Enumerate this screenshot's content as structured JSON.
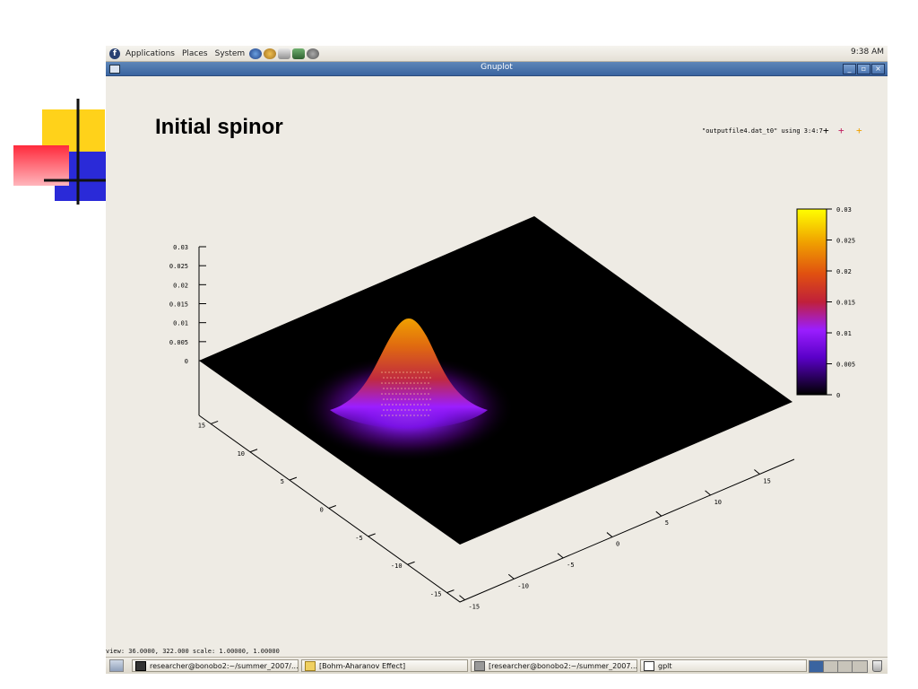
{
  "colors": {
    "slide_yellow": "#ffd21a",
    "slide_red": "#ff3344",
    "slide_blue": "#2a2ad8",
    "titlebar": "#3a64a0",
    "plot_surface": "#000000",
    "palette": [
      "#000000",
      "#5a00c8",
      "#9b1eff",
      "#c0203a",
      "#e05010",
      "#f0a000",
      "#ffff00"
    ]
  },
  "top_panel": {
    "menus": [
      "Applications",
      "Places",
      "System"
    ],
    "clock": "9:38 AM"
  },
  "window": {
    "title": "Gnuplot",
    "buttons": [
      "_",
      "▫",
      "×"
    ]
  },
  "chart_data": {
    "type": "surface",
    "title": "Initial spinor",
    "legend": "\"outputfile4.dat_t0\" using 3:4:7",
    "z_ticks": [
      "0",
      "0.005",
      "0.01",
      "0.015",
      "0.02",
      "0.025",
      "0.03"
    ],
    "zlim": [
      0,
      0.03
    ],
    "x_ticks": [
      "15",
      "10",
      "5",
      "0",
      "-5",
      "-10",
      "-15"
    ],
    "y_ticks": [
      "-15",
      "-10",
      "-5",
      "0",
      "5",
      "10",
      "15"
    ],
    "xlim": [
      -15,
      15
    ],
    "ylim": [
      -15,
      15
    ],
    "colorbar": {
      "ticks": [
        "0",
        "0.005",
        "0.01",
        "0.015",
        "0.02",
        "0.025",
        "0.03"
      ],
      "range": [
        0,
        0.03
      ]
    },
    "peak": {
      "value": 0.03
    }
  },
  "status": {
    "view": "view: 36.0000, 322.000 scale: 1.00000, 1.00000"
  },
  "taskbar": {
    "tasks": [
      "researcher@bonobo2:~/summer_2007/...",
      "[Bohm-Aharanov Effect]",
      "[researcher@bonobo2:~/summer_2007...",
      "gplt"
    ]
  }
}
